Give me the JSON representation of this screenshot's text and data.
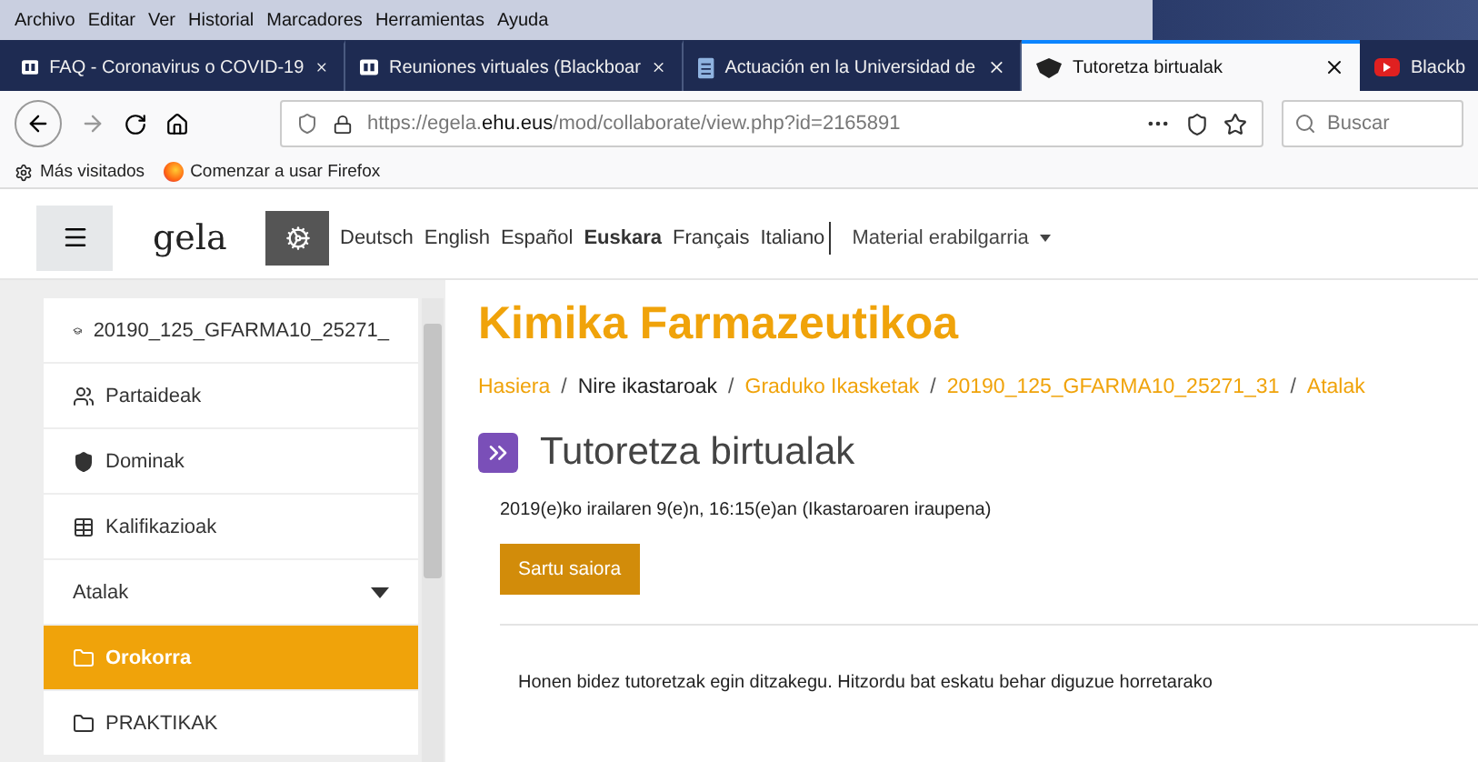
{
  "menu_bar": [
    "Archivo",
    "Editar",
    "Ver",
    "Historial",
    "Marcadores",
    "Herramientas",
    "Ayuda"
  ],
  "tabs": [
    {
      "label": "FAQ - Coronavirus o COVID-19",
      "selected": false
    },
    {
      "label": "Reuniones virtuales (Blackboar",
      "selected": false
    },
    {
      "label": "Actuación en la Universidad de",
      "selected": false
    },
    {
      "label": "Tutoretza birtualak",
      "selected": true
    },
    {
      "label": "Blackb",
      "selected": false
    }
  ],
  "address": {
    "url": "https://egela.**ehu.eus**/mod/collaborate/view.php?id=2165891"
  },
  "search": {
    "placeholder": "Buscar"
  },
  "bookmarks": [
    "Más visitados",
    "Comenzar a usar Firefox"
  ],
  "site_nav": {
    "logo": "gela",
    "languages": [
      {
        "label": "Deutsch",
        "selected": false
      },
      {
        "label": "English",
        "selected": false
      },
      {
        "label": "Español",
        "selected": false
      },
      {
        "label": "Euskara",
        "selected": true
      },
      {
        "label": "Français",
        "selected": false
      },
      {
        "label": "Italiano",
        "selected": false
      }
    ],
    "menu": "Material erabilgarria"
  },
  "sidebar": {
    "items": [
      {
        "label": "20190_125_GFARMA10_25271_",
        "kind": "course",
        "selected": false
      },
      {
        "label": "Partaideak",
        "kind": "participants",
        "selected": false
      },
      {
        "label": "Dominak",
        "kind": "badges",
        "selected": false
      },
      {
        "label": "Kalifikazioak",
        "kind": "grades",
        "selected": false
      },
      {
        "label": "Atalak",
        "kind": "header",
        "selected": false
      },
      {
        "label": "Orokorra",
        "kind": "folder",
        "selected": true
      },
      {
        "label": "PRAKTIKAK",
        "kind": "folder",
        "selected": false
      }
    ]
  },
  "page": {
    "title": "Kimika Farmazeutikoa",
    "breadcrumb_separator": "/",
    "breadcrumb": [
      {
        "label": "Hasiera",
        "kind": "link"
      },
      {
        "label": "Nire ikastaroak",
        "kind": "plain"
      },
      {
        "label": "Graduko Ikasketak",
        "kind": "link"
      },
      {
        "label": "20190_125_GFARMA10_25271_31",
        "kind": "link"
      },
      {
        "label": "Atalak",
        "kind": "link"
      }
    ],
    "activity_title": "Tutoretza birtualak",
    "date": "2019(e)ko irailaren 9(e)n, 16:15(e)an (Ikastaroaren iraupena)",
    "button": "Sartu saiora",
    "body": "Honen bidez tutoretzak egin ditzakegu. Hitzordu bat eskatu behar diguzue horretarako"
  }
}
